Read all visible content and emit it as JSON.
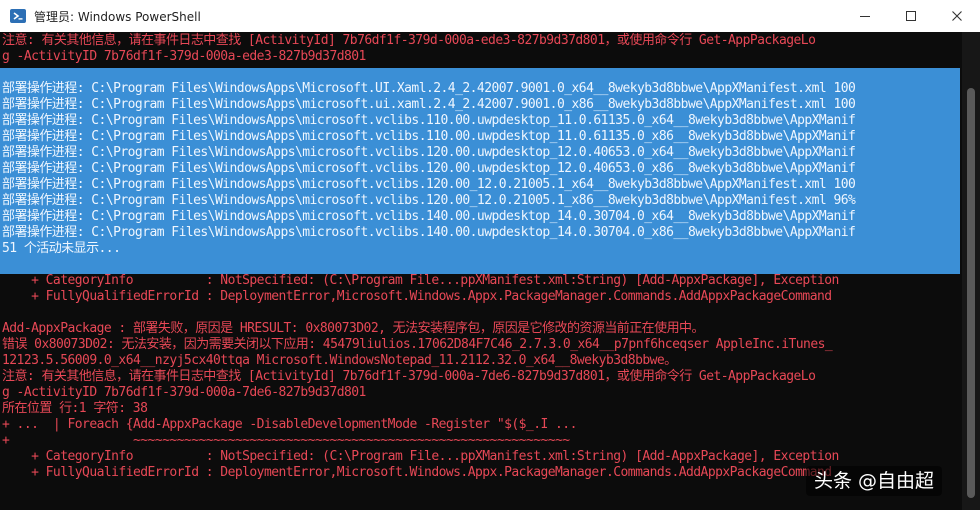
{
  "window": {
    "title": "管理员: Windows PowerShell",
    "icon": "powershell-icon",
    "controls": [
      "minimize-icon",
      "maximize-icon",
      "close-icon"
    ]
  },
  "console": {
    "top_lines": [
      "注意: 有关其他信息，请在事件日志中查找 [ActivityId] 7b76df1f-379d-000a-ede3-827b9d37d801，或使用命令行 Get-AppPackageLo",
      "g -ActivityID 7b76df1f-379d-000a-ede3-827b9d37d801"
    ],
    "progress_lines": [
      "部署操作进程: C:\\Program Files\\WindowsApps\\Microsoft.UI.Xaml.2.4_2.42007.9001.0_x64__8wekyb3d8bbwe\\AppXManifest.xml 100",
      "部署操作进程: C:\\Program Files\\WindowsApps\\microsoft.ui.xaml.2.4_2.42007.9001.0_x86__8wekyb3d8bbwe\\AppXManifest.xml 100",
      "部署操作进程: C:\\Program Files\\WindowsApps\\microsoft.vclibs.110.00.uwpdesktop_11.0.61135.0_x64__8wekyb3d8bbwe\\AppXManif",
      "部署操作进程: C:\\Program Files\\WindowsApps\\microsoft.vclibs.110.00.uwpdesktop_11.0.61135.0_x86__8wekyb3d8bbwe\\AppXManif",
      "部署操作进程: C:\\Program Files\\WindowsApps\\microsoft.vclibs.120.00.uwpdesktop_12.0.40653.0_x64__8wekyb3d8bbwe\\AppXManif",
      "部署操作进程: C:\\Program Files\\WindowsApps\\microsoft.vclibs.120.00.uwpdesktop_12.0.40653.0_x86__8wekyb3d8bbwe\\AppXManif",
      "部署操作进程: C:\\Program Files\\WindowsApps\\microsoft.vclibs.120.00_12.0.21005.1_x64__8wekyb3d8bbwe\\AppXManifest.xml 100",
      "部署操作进程: C:\\Program Files\\WindowsApps\\microsoft.vclibs.120.00_12.0.21005.1_x86__8wekyb3d8bbwe\\AppXManifest.xml 96%",
      "部署操作进程: C:\\Program Files\\WindowsApps\\microsoft.vclibs.140.00.uwpdesktop_14.0.30704.0_x64__8wekyb3d8bbwe\\AppXManif",
      "部署操作进程: C:\\Program Files\\WindowsApps\\microsoft.vclibs.140.00.uwpdesktop_14.0.30704.0_x86__8wekyb3d8bbwe\\AppXManif",
      "51 个活动未显示..."
    ],
    "error1": [
      "    + CategoryInfo          : NotSpecified: (C:\\Program File...ppXManifest.xml:String) [Add-AppxPackage], Exception",
      "    + FullyQualifiedErrorId : DeploymentError,Microsoft.Windows.Appx.PackageManager.Commands.AddAppxPackageCommand"
    ],
    "error2": [
      "Add-AppxPackage : 部署失败，原因是 HRESULT: 0x80073D02, 无法安装程序包，原因是它修改的资源当前正在使用中。",
      "错误 0x80073D02: 无法安装，因为需要关闭以下应用: 45479liulios.17062D84F7C46_2.7.3.0_x64__p7pnf6hceqser AppleInc.iTunes_",
      "12123.5.56009.0_x64__nzyj5cx40ttqa Microsoft.WindowsNotepad_11.2112.32.0_x64__8wekyb3d8bbwe。",
      "注意: 有关其他信息，请在事件日志中查找 [ActivityId] 7b76df1f-379d-000a-7de6-827b9d37d801，或使用命令行 Get-AppPackageLo",
      "g -ActivityID 7b76df1f-379d-000a-7de6-827b9d37d801",
      "所在位置 行:1 字符: 38",
      "+ ...  | Foreach {Add-AppxPackage -DisableDevelopmentMode -Register \"$($_.I ...",
      "+                 ~~~~~~~~~~~~~~~~~~~~~~~~~~~~~~~~~~~~~~~~~~~~~~~~~~~~~~~~~~~~",
      "    + CategoryInfo          : NotSpecified: (C:\\Program File...ppXManifest.xml:String) [Add-AppxPackage], Exception",
      "    + FullyQualifiedErrorId : DeploymentError,Microsoft.Windows.Appx.PackageManager.Commands.AddAppxPackageCommand"
    ]
  },
  "watermark": "头条 @自由超",
  "colors": {
    "error_text": "#e74856",
    "progress_bg": "#3b8fd6",
    "console_bg": "#0c0c0c"
  }
}
